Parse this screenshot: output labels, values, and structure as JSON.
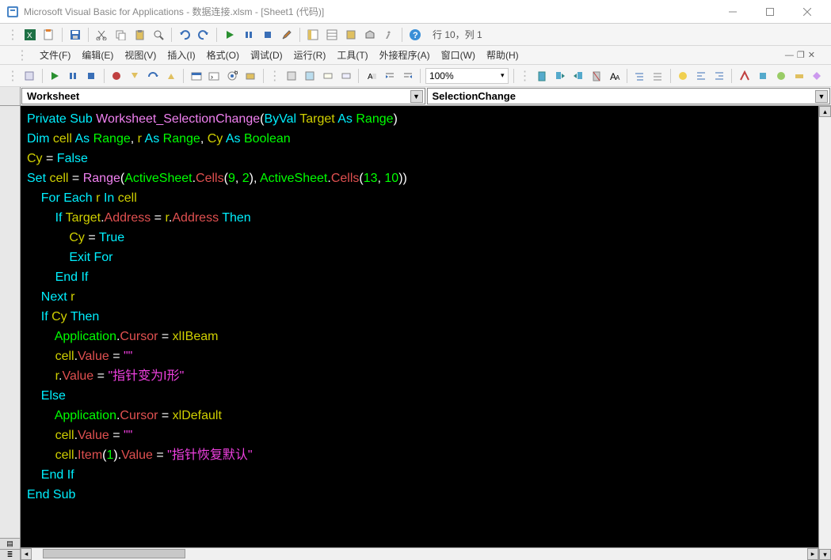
{
  "window": {
    "title": "Microsoft Visual Basic for Applications - 数据连接.xlsm - [Sheet1 (代码)]"
  },
  "status": {
    "cursor_pos": "行 10，列 1"
  },
  "menus": {
    "file": "文件(F)",
    "edit": "编辑(E)",
    "view": "视图(V)",
    "insert": "插入(I)",
    "format": "格式(O)",
    "debug": "调试(D)",
    "run": "运行(R)",
    "tools": "工具(T)",
    "addins": "外接程序(A)",
    "window": "窗口(W)",
    "help": "帮助(H)"
  },
  "zoom": "100%",
  "combos": {
    "object": "Worksheet",
    "procedure": "SelectionChange"
  },
  "code": {
    "lines": [
      [
        [
          "kw",
          "Private Sub"
        ],
        [
          "op",
          " "
        ],
        [
          "func",
          "Worksheet_SelectionChange"
        ],
        [
          "op",
          "("
        ],
        [
          "kw",
          "ByVal"
        ],
        [
          "op",
          " "
        ],
        [
          "id",
          "Target"
        ],
        [
          "op",
          " "
        ],
        [
          "kw",
          "As"
        ],
        [
          "op",
          " "
        ],
        [
          "type",
          "Range"
        ],
        [
          "op",
          ")"
        ]
      ],
      [
        [
          "kw",
          "Dim"
        ],
        [
          "op",
          " "
        ],
        [
          "id",
          "cell"
        ],
        [
          "op",
          " "
        ],
        [
          "kw",
          "As"
        ],
        [
          "op",
          " "
        ],
        [
          "type",
          "Range"
        ],
        [
          "op",
          ", "
        ],
        [
          "id",
          "r"
        ],
        [
          "op",
          " "
        ],
        [
          "kw",
          "As"
        ],
        [
          "op",
          " "
        ],
        [
          "type",
          "Range"
        ],
        [
          "op",
          ", "
        ],
        [
          "id",
          "Cy"
        ],
        [
          "op",
          " "
        ],
        [
          "kw",
          "As"
        ],
        [
          "op",
          " "
        ],
        [
          "type",
          "Boolean"
        ]
      ],
      [
        [
          "id",
          "Cy"
        ],
        [
          "op",
          " = "
        ],
        [
          "kw",
          "False"
        ]
      ],
      [
        [
          "kw",
          "Set"
        ],
        [
          "op",
          " "
        ],
        [
          "id",
          "cell"
        ],
        [
          "op",
          " = "
        ],
        [
          "func",
          "Range"
        ],
        [
          "op",
          "("
        ],
        [
          "obj",
          "ActiveSheet"
        ],
        [
          "op",
          "."
        ],
        [
          "prop",
          "Cells"
        ],
        [
          "op",
          "("
        ],
        [
          "num",
          "9"
        ],
        [
          "op",
          ", "
        ],
        [
          "num",
          "2"
        ],
        [
          "op",
          "), "
        ],
        [
          "obj",
          "ActiveSheet"
        ],
        [
          "op",
          "."
        ],
        [
          "prop",
          "Cells"
        ],
        [
          "op",
          "("
        ],
        [
          "num",
          "13"
        ],
        [
          "op",
          ", "
        ],
        [
          "num",
          "10"
        ],
        [
          "op",
          "))"
        ]
      ],
      [
        [
          "op",
          "    "
        ],
        [
          "kw",
          "For Each"
        ],
        [
          "op",
          " "
        ],
        [
          "id",
          "r"
        ],
        [
          "op",
          " "
        ],
        [
          "kw",
          "In"
        ],
        [
          "op",
          " "
        ],
        [
          "id",
          "cell"
        ]
      ],
      [
        [
          "op",
          "        "
        ],
        [
          "kw",
          "If"
        ],
        [
          "op",
          " "
        ],
        [
          "id",
          "Target"
        ],
        [
          "op",
          "."
        ],
        [
          "prop",
          "Address"
        ],
        [
          "op",
          " = "
        ],
        [
          "id",
          "r"
        ],
        [
          "op",
          "."
        ],
        [
          "prop",
          "Address"
        ],
        [
          "op",
          " "
        ],
        [
          "kw",
          "Then"
        ]
      ],
      [
        [
          "op",
          "            "
        ],
        [
          "id",
          "Cy"
        ],
        [
          "op",
          " = "
        ],
        [
          "kw",
          "True"
        ]
      ],
      [
        [
          "op",
          "            "
        ],
        [
          "kw",
          "Exit For"
        ]
      ],
      [
        [
          "op",
          "        "
        ],
        [
          "kw",
          "End If"
        ]
      ],
      [
        [
          "op",
          "    "
        ],
        [
          "kw",
          "Next"
        ],
        [
          "op",
          " "
        ],
        [
          "id",
          "r"
        ]
      ],
      [
        [
          "op",
          "    "
        ],
        [
          "kw",
          "If"
        ],
        [
          "op",
          " "
        ],
        [
          "id",
          "Cy"
        ],
        [
          "op",
          " "
        ],
        [
          "kw",
          "Then"
        ]
      ],
      [
        [
          "op",
          "        "
        ],
        [
          "obj",
          "Application"
        ],
        [
          "op",
          "."
        ],
        [
          "prop",
          "Cursor"
        ],
        [
          "op",
          " = "
        ],
        [
          "id",
          "xlIBeam"
        ]
      ],
      [
        [
          "op",
          "        "
        ],
        [
          "id",
          "cell"
        ],
        [
          "op",
          "."
        ],
        [
          "prop",
          "Value"
        ],
        [
          "op",
          " = "
        ],
        [
          "str",
          "\"\""
        ]
      ],
      [
        [
          "op",
          "        "
        ],
        [
          "id",
          "r"
        ],
        [
          "op",
          "."
        ],
        [
          "prop",
          "Value"
        ],
        [
          "op",
          " = "
        ],
        [
          "str",
          "\"指针变为I形\""
        ]
      ],
      [
        [
          "op",
          "    "
        ],
        [
          "kw",
          "Else"
        ]
      ],
      [
        [
          "op",
          "        "
        ],
        [
          "obj",
          "Application"
        ],
        [
          "op",
          "."
        ],
        [
          "prop",
          "Cursor"
        ],
        [
          "op",
          " = "
        ],
        [
          "id",
          "xlDefault"
        ]
      ],
      [
        [
          "op",
          "        "
        ],
        [
          "id",
          "cell"
        ],
        [
          "op",
          "."
        ],
        [
          "prop",
          "Value"
        ],
        [
          "op",
          " = "
        ],
        [
          "str",
          "\"\""
        ]
      ],
      [
        [
          "op",
          "        "
        ],
        [
          "id",
          "cell"
        ],
        [
          "op",
          "."
        ],
        [
          "prop",
          "Item"
        ],
        [
          "op",
          "("
        ],
        [
          "num",
          "1"
        ],
        [
          "op",
          ")."
        ],
        [
          "prop",
          "Value"
        ],
        [
          "op",
          " = "
        ],
        [
          "str",
          "\"指针恢复默认\""
        ]
      ],
      [
        [
          "op",
          "    "
        ],
        [
          "kw",
          "End If"
        ]
      ],
      [
        [
          "kw",
          "End Sub"
        ]
      ]
    ]
  }
}
